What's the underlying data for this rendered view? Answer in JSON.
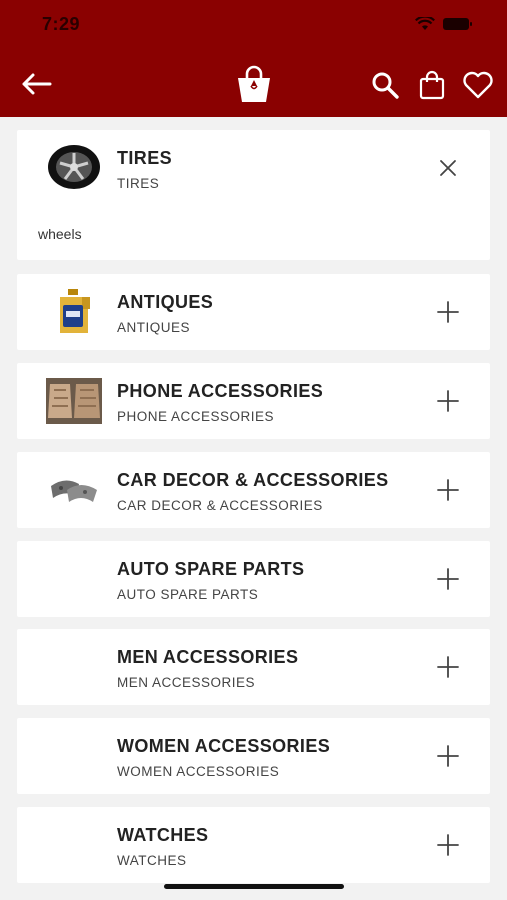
{
  "status_bar": {
    "time": "7:29"
  },
  "header": {
    "back_icon": "arrow-left-icon",
    "logo_icon": "shopping-bag-logo",
    "actions": [
      "search-icon",
      "shopping-bag-icon",
      "heart-icon"
    ]
  },
  "colors": {
    "header_bg": "#8a0101",
    "page_bg": "#f2f2f2",
    "card_bg": "#ffffff"
  },
  "categories": [
    {
      "title": "TIRES",
      "subtitle": "TIRES",
      "image": "alloy-wheel",
      "expanded": true,
      "children": [
        "wheels"
      ],
      "toggle": "close-icon"
    },
    {
      "title": "ANTIQUES",
      "subtitle": "ANTIQUES",
      "image": "oil-bottle",
      "expanded": false,
      "toggle": "plus-icon"
    },
    {
      "title": "PHONE ACCESSORIES",
      "subtitle": "PHONE ACCESSORIES",
      "image": "car-seat-mats",
      "expanded": false,
      "toggle": "plus-icon"
    },
    {
      "title": "CAR DECOR &  ACCESSORIES",
      "subtitle": "CAR DECOR &  ACCESSORIES",
      "image": "brake-pads",
      "expanded": false,
      "toggle": "plus-icon"
    },
    {
      "title": "AUTO SPARE PARTS",
      "subtitle": "AUTO SPARE PARTS",
      "image": "",
      "expanded": false,
      "toggle": "plus-icon"
    },
    {
      "title": "MEN ACCESSORIES",
      "subtitle": "MEN ACCESSORIES",
      "image": "",
      "expanded": false,
      "toggle": "plus-icon"
    },
    {
      "title": "WOMEN ACCESSORIES",
      "subtitle": "WOMEN ACCESSORIES",
      "image": "",
      "expanded": false,
      "toggle": "plus-icon"
    },
    {
      "title": "WATCHES",
      "subtitle": "WATCHES",
      "image": "",
      "expanded": false,
      "toggle": "plus-icon"
    }
  ]
}
